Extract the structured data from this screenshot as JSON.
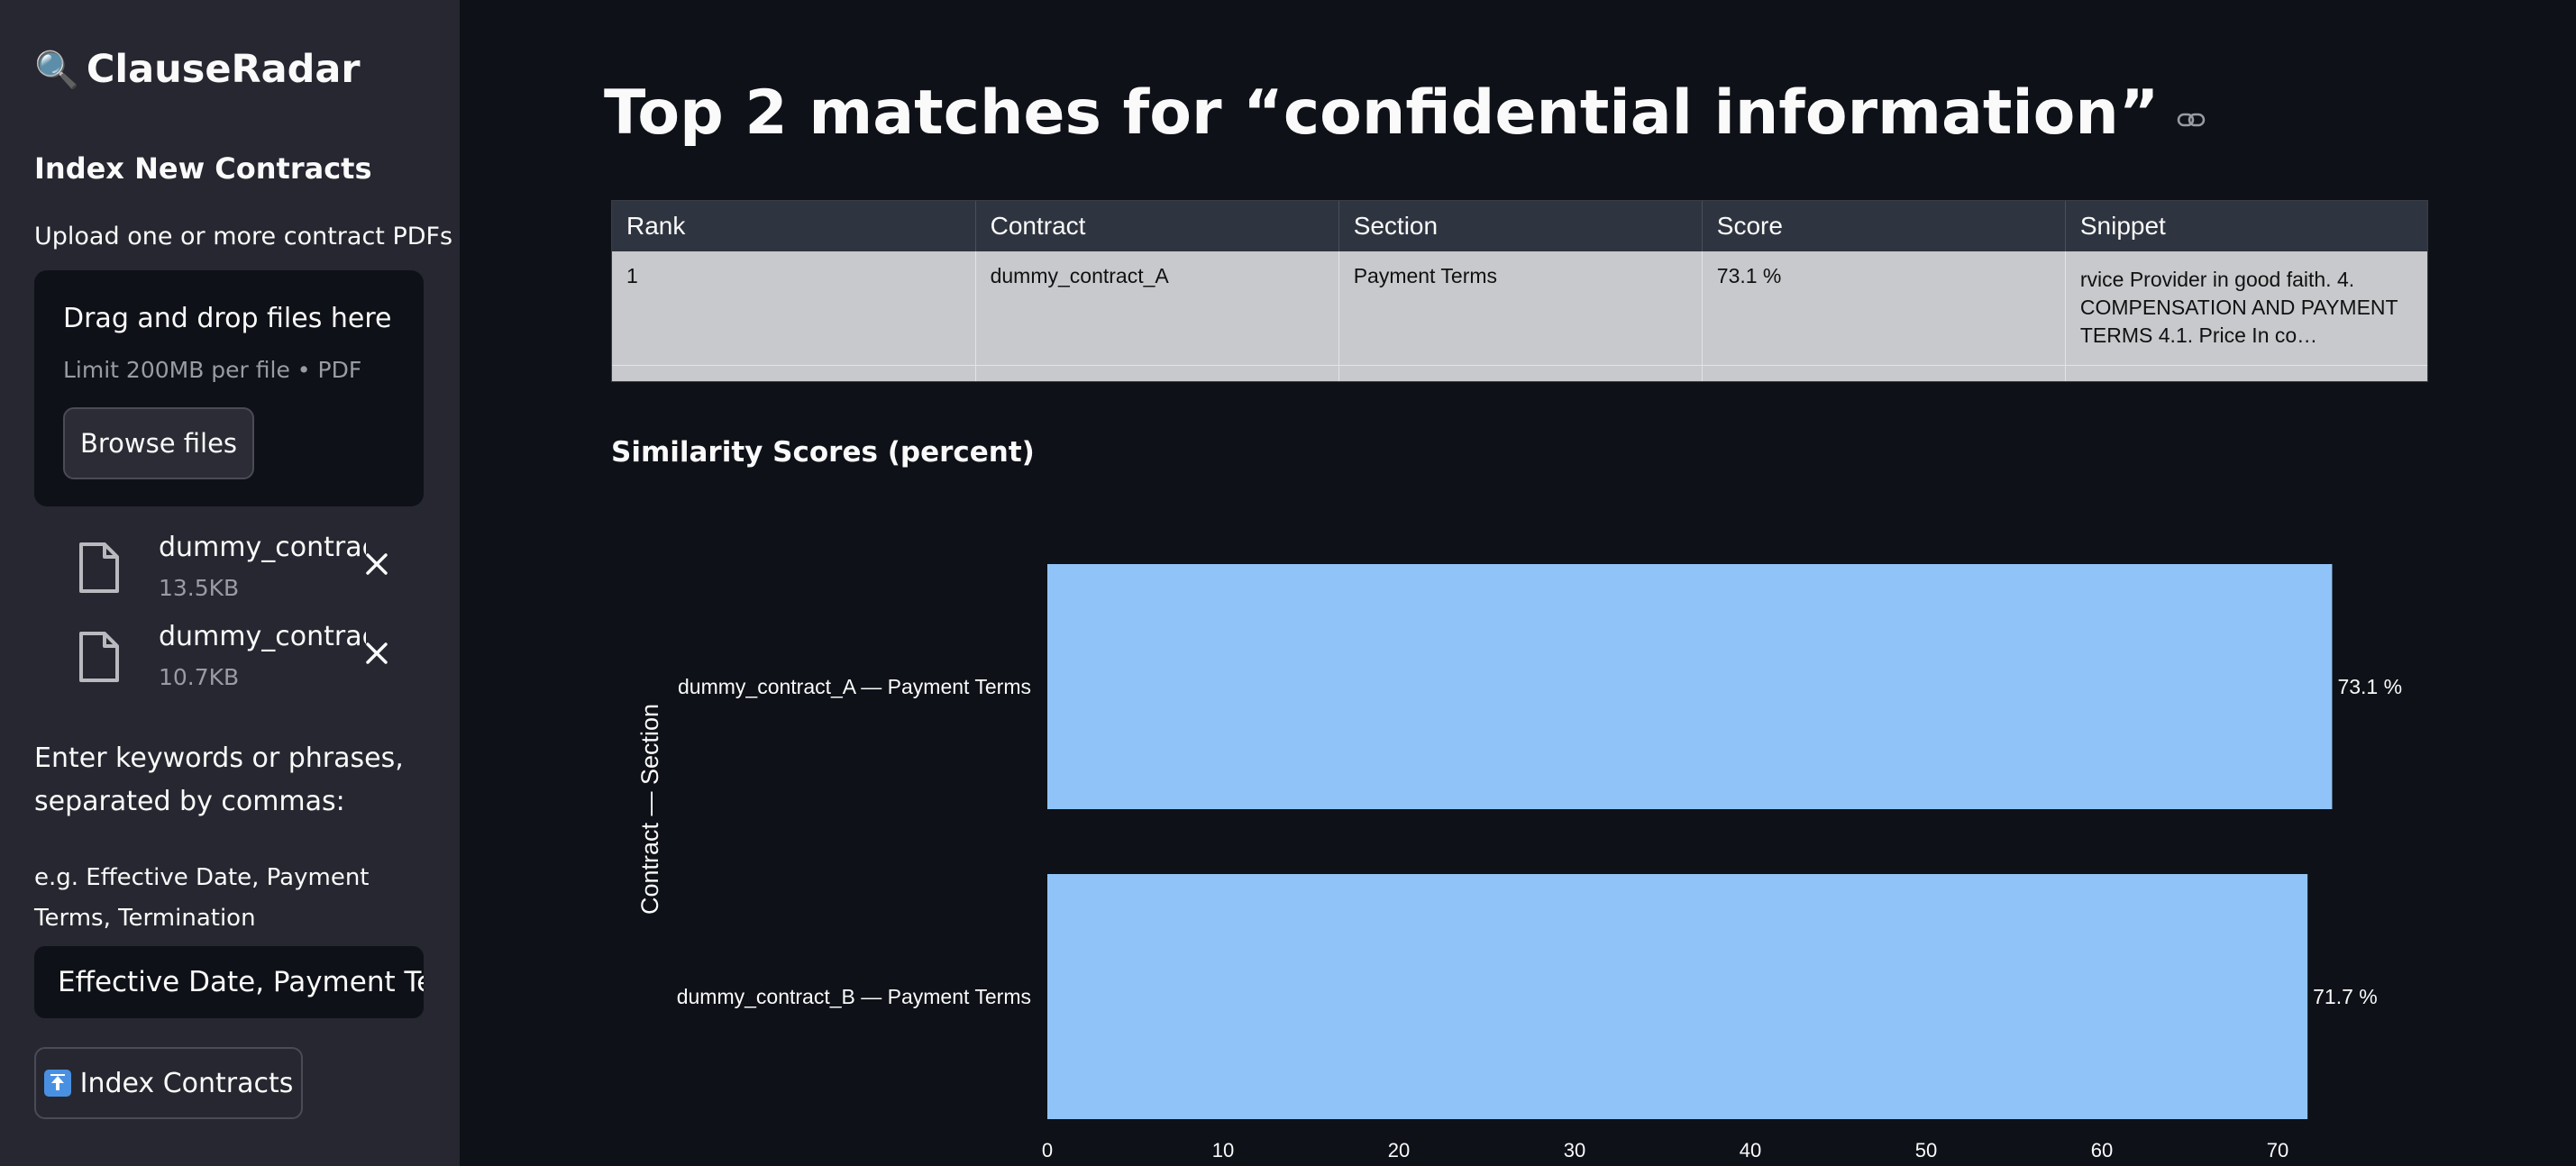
{
  "sidebar": {
    "app_title": "ClauseRadar",
    "index_header": "Index New Contracts",
    "upload_label": "Upload one or more contract PDFs",
    "dropzone": {
      "title": "Drag and drop files here",
      "limit": "Limit 200MB per file • PDF",
      "browse_label": "Browse files"
    },
    "files": [
      {
        "name": "dummy_contract_A.pdf",
        "size": "13.5KB"
      },
      {
        "name": "dummy_contract_B.pdf",
        "size": "10.7KB"
      }
    ],
    "keywords_label": "Enter keywords or phrases, separated by commas:",
    "keywords_help": "e.g. Effective Date, Payment Terms, Termination",
    "keywords_value": "Effective Date, Payment Terms",
    "index_button": "Index Contracts"
  },
  "main": {
    "title": "Top 2 matches for “confidential information”",
    "table": {
      "columns": [
        "Rank",
        "Contract",
        "Section",
        "Score",
        "Snippet"
      ],
      "rows": [
        [
          "1",
          "dummy_contract_A",
          "Payment Terms",
          "73.1 %",
          "rvice Provider in good faith. 4. COMPENSATION AND PAYMENT TERMS 4.1. Price In co…"
        ]
      ]
    },
    "chart_title": "Similarity Scores (percent)"
  },
  "colors": {
    "background": "#0e1117",
    "sidebar": "#262730",
    "bar": "#90c4f8",
    "table_cell": "#c8c9cc",
    "table_header": "#2f3540"
  },
  "chart_data": {
    "type": "bar",
    "orientation": "horizontal",
    "categories": [
      "dummy_contract_A — Payment Terms",
      "dummy_contract_B — Payment Terms"
    ],
    "values": [
      73.1,
      71.7
    ],
    "value_labels": [
      "73.1 %",
      "71.7 %"
    ],
    "ylabel": "Contract — Section",
    "xlabel": "",
    "xlim": [
      0,
      75
    ],
    "xticks": [
      0,
      10,
      20,
      30,
      40,
      50,
      60,
      70
    ],
    "grid": false
  }
}
